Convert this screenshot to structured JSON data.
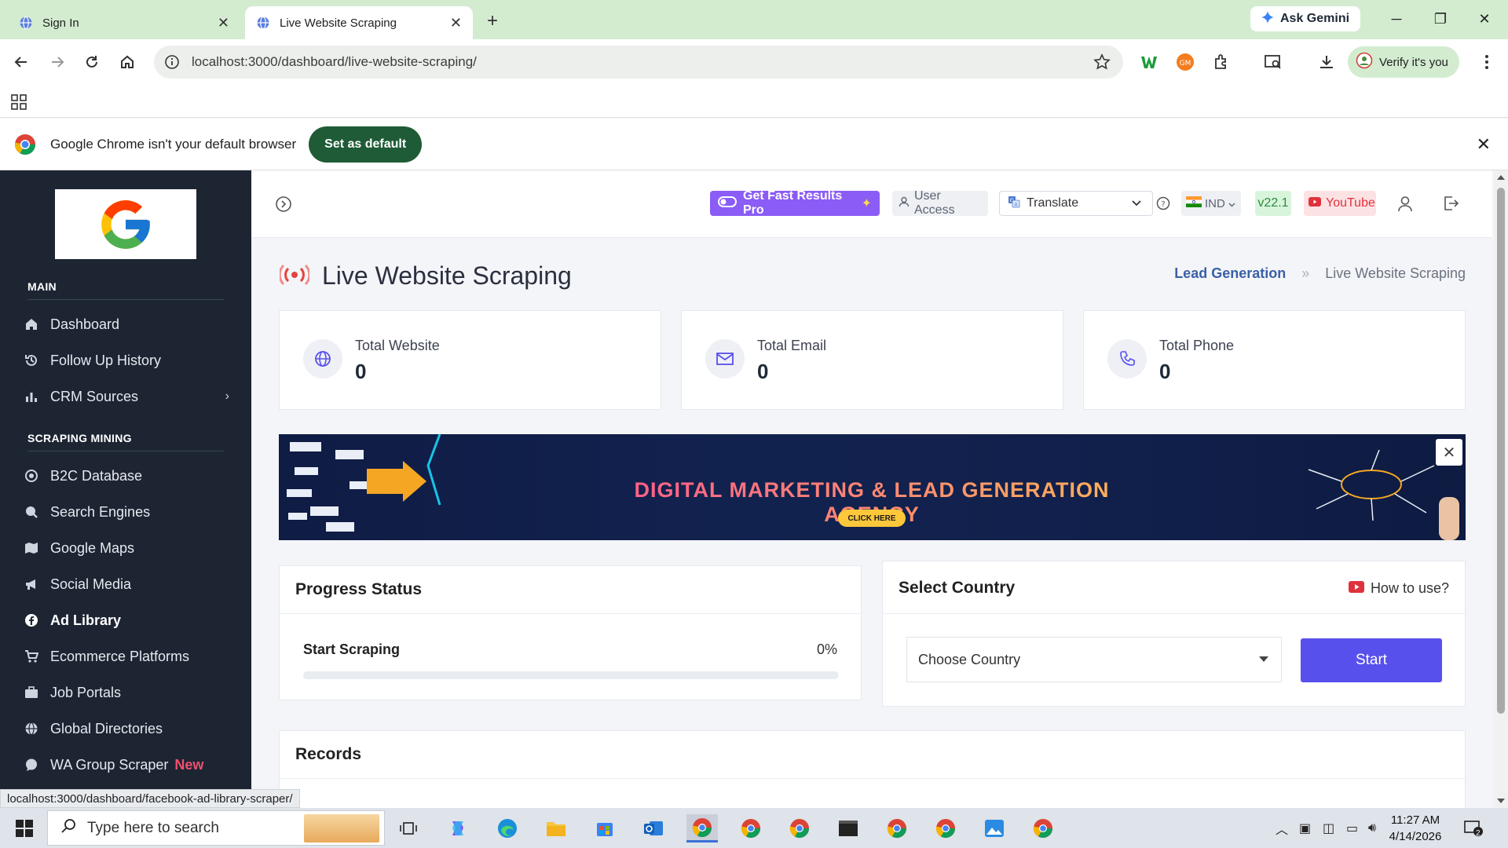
{
  "browser": {
    "tabs": [
      {
        "title": "Sign In"
      },
      {
        "title": "Live Website Scraping"
      }
    ],
    "ask_gemini": "Ask Gemini",
    "url": "localhost:3000/dashboard/live-website-scraping/",
    "verify_label": "Verify it's you",
    "default_bar": {
      "message": "Google Chrome isn't your default browser",
      "button": "Set as default"
    },
    "status_url": "localhost:3000/dashboard/facebook-ad-library-scraper/"
  },
  "sidebar": {
    "sections": [
      {
        "title": "MAIN"
      },
      {
        "title": "SCRAPING MINING"
      }
    ],
    "main_items": [
      {
        "label": "Dashboard",
        "icon": "home-icon"
      },
      {
        "label": "Follow Up History",
        "icon": "history-icon"
      },
      {
        "label": "CRM Sources",
        "icon": "bar-chart-icon"
      }
    ],
    "scraping_items": [
      {
        "label": "B2C Database",
        "icon": "database-icon"
      },
      {
        "label": "Search Engines",
        "icon": "search-icon"
      },
      {
        "label": "Google Maps",
        "icon": "map-icon"
      },
      {
        "label": "Social Media",
        "icon": "megaphone-icon"
      },
      {
        "label": "Ad Library",
        "icon": "facebook-icon"
      },
      {
        "label": "Ecommerce Platforms",
        "icon": "cart-icon"
      },
      {
        "label": "Job Portals",
        "icon": "briefcase-icon"
      },
      {
        "label": "Global Directories",
        "icon": "globe-icon"
      },
      {
        "label": "WA Group Scraper",
        "icon": "whatsapp-icon",
        "badge": "New"
      }
    ]
  },
  "header": {
    "pro": "Get Fast Results Pro",
    "user_access": "User Access",
    "translate": "Translate",
    "country": "IND",
    "version": "v22.1",
    "youtube": "YouTube"
  },
  "page": {
    "title": "Live Website Scraping",
    "breadcrumb": {
      "parent": "Lead Generation",
      "current": "Live Website Scraping"
    },
    "stats": [
      {
        "label": "Total Website",
        "value": "0",
        "icon": "globe-icon"
      },
      {
        "label": "Total Email",
        "value": "0",
        "icon": "mail-icon"
      },
      {
        "label": "Total Phone",
        "value": "0",
        "icon": "phone-icon"
      }
    ],
    "banner": {
      "headline": "DIGITAL MARKETING & LEAD GENERATION AGENCY",
      "cta": "CLICK HERE"
    },
    "progress": {
      "title": "Progress Status",
      "label": "Start Scraping",
      "percent_text": "0%",
      "percent": 0
    },
    "country": {
      "title": "Select Country",
      "how_to": "How to use?",
      "placeholder": "Choose Country",
      "start": "Start"
    },
    "records": {
      "title": "Records"
    }
  },
  "taskbar": {
    "search_placeholder": "Type here to search",
    "time": "11:27 AM",
    "date": "4/14/2026",
    "notifications": "2"
  },
  "colors": {
    "accent": "#5850ec",
    "sidebar_bg": "#1d2533",
    "pro_bg": "#8b5cf6",
    "youtube": "#e0323c"
  }
}
